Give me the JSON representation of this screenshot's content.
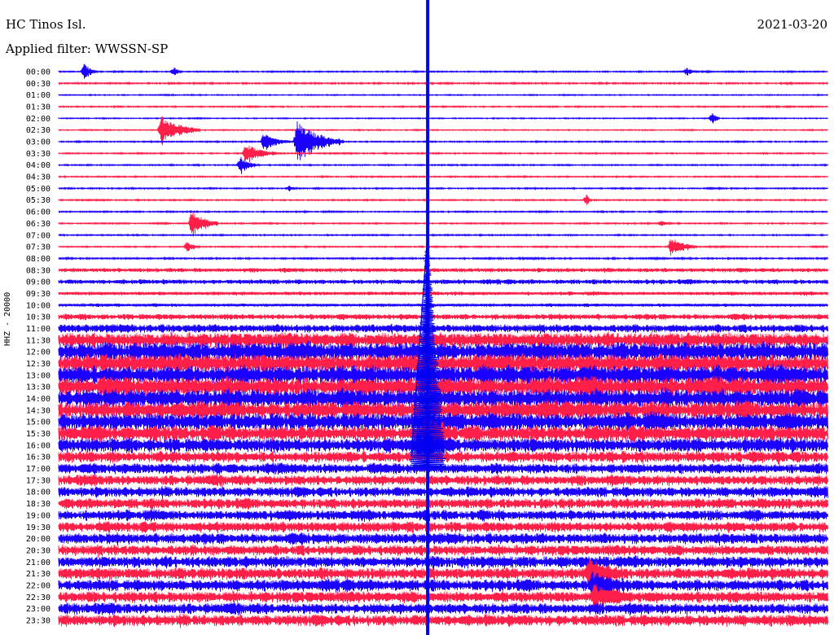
{
  "header": {
    "station": "HC Tinos Isl.",
    "filter": "Applied filter: WWSSN-SP",
    "date": "2021-03-20"
  },
  "ylabel": "HHZ - 20000",
  "colors": {
    "odd_trace": "#1b00ff",
    "even_trace": "#ff1f48",
    "marker": "#0000ee"
  },
  "chart_data": {
    "type": "line",
    "title": "",
    "xlabel": "",
    "ylabel": "HHZ - 20000",
    "grid": false,
    "row_labels": [
      "00:00",
      "00:30",
      "01:00",
      "01:30",
      "02:00",
      "02:30",
      "03:00",
      "03:30",
      "04:00",
      "04:30",
      "05:00",
      "05:30",
      "06:00",
      "06:30",
      "07:00",
      "07:30",
      "08:00",
      "08:30",
      "09:00",
      "09:30",
      "10:00",
      "10:30",
      "11:00",
      "11:30",
      "12:00",
      "12:30",
      "13:00",
      "13:30",
      "14:00",
      "14:30",
      "15:00",
      "15:30",
      "16:00",
      "16:30",
      "17:00",
      "17:30",
      "18:00",
      "18:30",
      "19:00",
      "19:30",
      "20:00",
      "20:30",
      "21:00",
      "21:30",
      "22:00",
      "22:30",
      "23:00",
      "23:30"
    ],
    "noise_level": [
      0.5,
      0.6,
      0.4,
      0.5,
      0.4,
      0.4,
      0.5,
      0.5,
      0.5,
      0.5,
      0.5,
      0.5,
      0.5,
      0.5,
      0.5,
      0.5,
      0.6,
      1.6,
      1.8,
      1.4,
      1.2,
      2.2,
      3.2,
      6,
      7.5,
      7.5,
      7.5,
      7.5,
      7.5,
      7,
      7,
      6,
      5.5,
      4.5,
      4,
      4,
      4,
      4,
      4,
      4,
      4.2,
      4.2,
      4.5,
      4.5,
      4.5,
      4.5,
      4.2,
      4.5
    ],
    "events": [
      {
        "row": 0,
        "minute": 1.0,
        "amplitude": 10,
        "duration": 0.5
      },
      {
        "row": 0,
        "minute": 4.5,
        "amplitude": 6,
        "duration": 0.3
      },
      {
        "row": 0,
        "minute": 24.5,
        "amplitude": 5,
        "duration": 0.4
      },
      {
        "row": 4,
        "minute": 25.5,
        "amplitude": 8,
        "duration": 0.3
      },
      {
        "row": 5,
        "minute": 4.0,
        "amplitude": 18,
        "duration": 1.5
      },
      {
        "row": 6,
        "minute": 8.0,
        "amplitude": 10,
        "duration": 1.0
      },
      {
        "row": 6,
        "minute": 9.3,
        "amplitude": 25,
        "duration": 1.8
      },
      {
        "row": 7,
        "minute": 7.3,
        "amplitude": 12,
        "duration": 1.2
      },
      {
        "row": 8,
        "minute": 7.1,
        "amplitude": 12,
        "duration": 0.6
      },
      {
        "row": 10,
        "minute": 9.0,
        "amplitude": 3,
        "duration": 0.3
      },
      {
        "row": 11,
        "minute": 20.6,
        "amplitude": 7,
        "duration": 0.2
      },
      {
        "row": 13,
        "minute": 5.2,
        "amplitude": 17,
        "duration": 1.0
      },
      {
        "row": 15,
        "minute": 5.0,
        "amplitude": 6,
        "duration": 0.5
      },
      {
        "row": 15,
        "minute": 23.9,
        "amplitude": 12,
        "duration": 1.0
      },
      {
        "row": 13,
        "minute": 23.5,
        "amplitude": 3,
        "duration": 0.4
      },
      {
        "row": 31,
        "minute": 14.3,
        "amplitude": 18,
        "duration": 1.2
      },
      {
        "row": 32,
        "minute": 14.0,
        "amplitude": 14,
        "duration": 1.5
      },
      {
        "row": 43,
        "minute": 20.7,
        "amplitude": 15,
        "duration": 1.5
      },
      {
        "row": 44,
        "minute": 20.8,
        "amplitude": 14,
        "duration": 1.5
      },
      {
        "row": 45,
        "minute": 20.9,
        "amplitude": 12,
        "duration": 1.2
      }
    ],
    "time_marker_minute": 14.4
  }
}
